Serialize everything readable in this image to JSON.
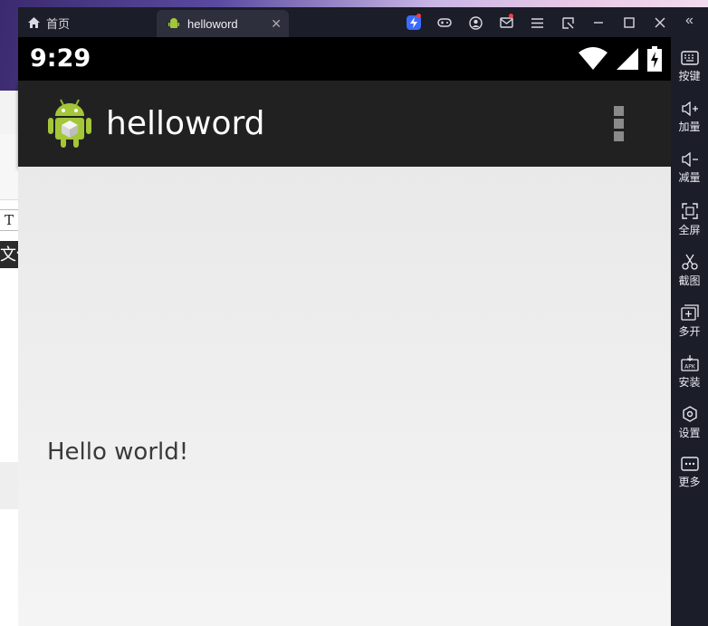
{
  "window": {
    "home_tab_label": "首页",
    "active_tab_label": "helloword",
    "close_glyph": "✕"
  },
  "android": {
    "status_time": "9:29",
    "app_title": "helloword",
    "body_text": "Hello world!"
  },
  "background_app": {
    "t_button": "T",
    "dark_bar_text": "文件"
  },
  "sidebar": {
    "items": [
      {
        "label": "按键",
        "icon": "keyboard-icon"
      },
      {
        "label": "加量",
        "icon": "volume-up-icon"
      },
      {
        "label": "减量",
        "icon": "volume-down-icon"
      },
      {
        "label": "全屏",
        "icon": "fullscreen-icon"
      },
      {
        "label": "截图",
        "icon": "scissors-icon"
      },
      {
        "label": "多开",
        "icon": "multi-instance-icon"
      },
      {
        "label": "安装",
        "icon": "apk-install-icon"
      },
      {
        "label": "设置",
        "icon": "settings-icon"
      },
      {
        "label": "更多",
        "icon": "more-icon"
      }
    ]
  },
  "colors": {
    "emulator_chrome": "#1b1d29",
    "action_bar": "#212121",
    "status_bar": "#000000",
    "content_bg": "#eeeeee",
    "notification_dot": "#ff3b3b",
    "boost_icon": "#3b6cff",
    "android_green": "#a4c639"
  }
}
